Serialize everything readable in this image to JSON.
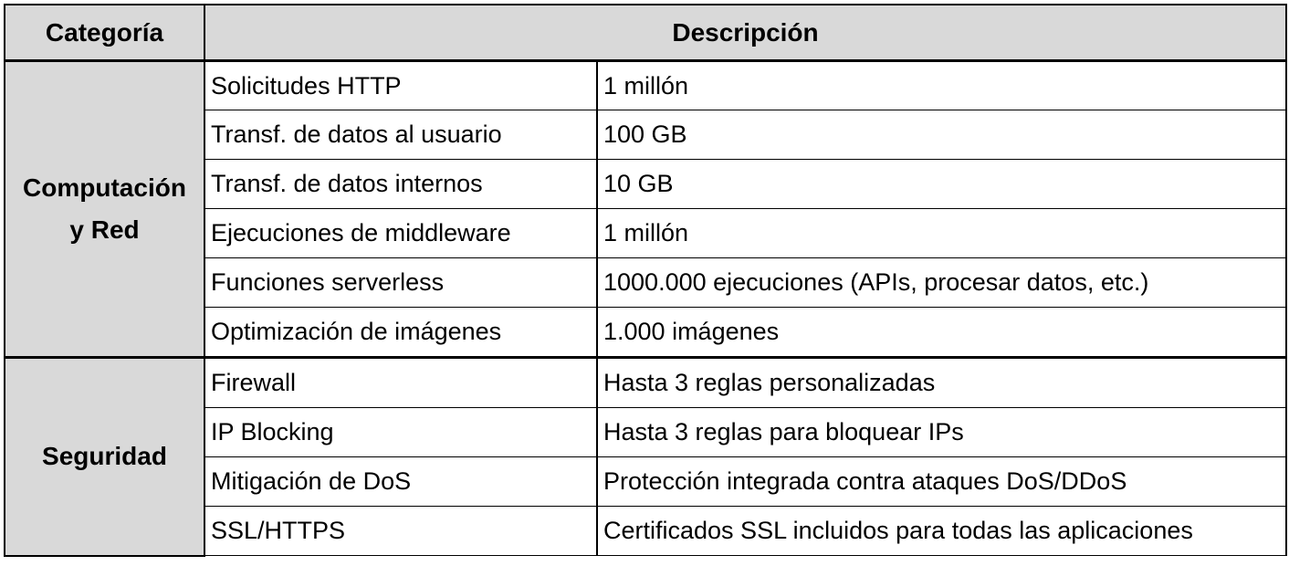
{
  "header": {
    "category_label": "Categoría",
    "description_label": "Descripción"
  },
  "groups": [
    {
      "category_line1": "Computación",
      "category_line2": "y Red",
      "rows": [
        {
          "item": "Solicitudes HTTP",
          "value": "1 millón"
        },
        {
          "item": "Transf. de datos al usuario",
          "value": "100 GB"
        },
        {
          "item": "Transf. de datos internos",
          "value": "10 GB"
        },
        {
          "item": "Ejecuciones de middleware",
          "value": "1 millón"
        },
        {
          "item": "Funciones serverless",
          "value": "1000.000 ejecuciones (APIs, procesar datos, etc.)"
        },
        {
          "item": "Optimización de imágenes",
          "value": "1.000 imágenes"
        }
      ]
    },
    {
      "category_line1": "Seguridad",
      "category_line2": "",
      "rows": [
        {
          "item": "Firewall",
          "value": "Hasta 3 reglas personalizadas"
        },
        {
          "item": "IP Blocking",
          "value": "Hasta 3 reglas para bloquear IPs"
        },
        {
          "item": "Mitigación de DoS",
          "value": "Protección integrada contra ataques DoS/DDoS"
        },
        {
          "item": "SSL/HTTPS",
          "value": "Certificados SSL incluidos para todas las aplicaciones"
        }
      ]
    }
  ],
  "colors": {
    "header_background": "#d9d9d9",
    "category_background": "#d9d9d9",
    "border": "#000000"
  }
}
